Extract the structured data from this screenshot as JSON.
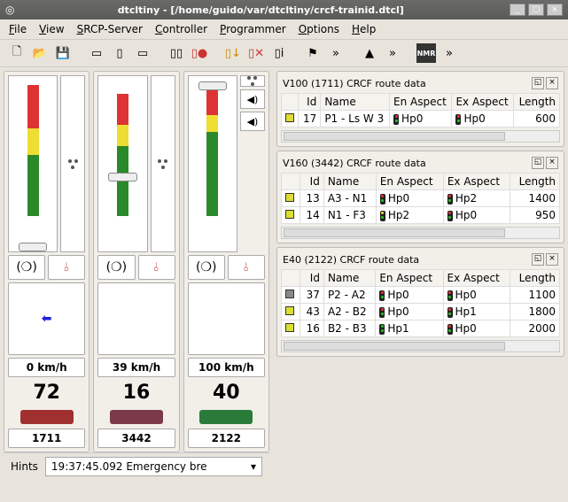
{
  "window": {
    "title": "dtcltiny - [/home/guido/var/dtcltiny/crcf-trainid.dtcl]"
  },
  "menu": {
    "file": "File",
    "view": "View",
    "srcp": "SRCP-Server",
    "controller": "Controller",
    "programmer": "Programmer",
    "options": "Options",
    "help": "Help"
  },
  "throttles": [
    {
      "speed": "0 km/h",
      "num": "72",
      "addr": "1711",
      "color": "#a03030",
      "handle": 95,
      "meter": [
        [
          70,
          25,
          "#d33"
        ],
        [
          55,
          15,
          "#ed3"
        ],
        [
          20,
          35,
          "#2a8a2a"
        ]
      ],
      "dots": true,
      "spk": false,
      "arrow": true
    },
    {
      "speed": "39 km/h",
      "num": "16",
      "addr": "3442",
      "color": "#7a3a4a",
      "handle": 55,
      "meter": [
        [
          72,
          18,
          "#d33"
        ],
        [
          60,
          12,
          "#ed3"
        ],
        [
          20,
          40,
          "#2a8a2a"
        ]
      ],
      "dots": true,
      "spk": false,
      "arrow": false
    },
    {
      "speed": "100 km/h",
      "num": "40",
      "addr": "2122",
      "color": "#2a7a3a",
      "handle": 3,
      "meter": [
        [
          78,
          18,
          "#d33"
        ],
        [
          68,
          10,
          "#ed3"
        ],
        [
          20,
          48,
          "#2a8a2a"
        ]
      ],
      "dots": true,
      "spk": true,
      "arrow": false
    }
  ],
  "routes": [
    {
      "title": "V100 (1711) CRCF route data",
      "cols": [
        "",
        "Id",
        "Name",
        "En Aspect",
        "Ex Aspect",
        "Length"
      ],
      "rows": [
        {
          "c": "#dd3",
          "id": "17",
          "name": "P1 - Ls W 3",
          "en": "Hp0",
          "ens": "rg",
          "ex": "Hp0",
          "exs": "rg",
          "len": "600"
        }
      ]
    },
    {
      "title": "V160 (3442) CRCF route data",
      "cols": [
        "",
        "Id",
        "Name",
        "En Aspect",
        "Ex Aspect",
        "Length"
      ],
      "rows": [
        {
          "c": "#dd3",
          "id": "13",
          "name": "A3 - N1",
          "en": "Hp0",
          "ens": "rg",
          "ex": "Hp2",
          "exs": "rg",
          "len": "1400"
        },
        {
          "c": "#dd3",
          "id": "14",
          "name": "N1 - F3",
          "en": "Hp2",
          "ens": "yg",
          "ex": "Hp0",
          "exs": "rg",
          "len": "950"
        }
      ]
    },
    {
      "title": "E40 (2122) CRCF route data",
      "cols": [
        "",
        "Id",
        "Name",
        "En Aspect",
        "Ex Aspect",
        "Length"
      ],
      "rows": [
        {
          "c": "#888",
          "id": "37",
          "name": "P2 - A2",
          "en": "Hp0",
          "ens": "rg",
          "ex": "Hp0",
          "exs": "rg",
          "len": "1100"
        },
        {
          "c": "#dd3",
          "id": "43",
          "name": "A2 - B2",
          "en": "Hp0",
          "ens": "rg",
          "ex": "Hp1",
          "exs": "rg",
          "len": "1800"
        },
        {
          "c": "#dd3",
          "id": "16",
          "name": "B2 - B3",
          "en": "Hp1",
          "ens": "gg",
          "ex": "Hp0",
          "exs": "rg",
          "len": "2000"
        }
      ]
    }
  ],
  "status": {
    "label": "Hints",
    "log": "19:37:45.092 Emergency bre"
  }
}
